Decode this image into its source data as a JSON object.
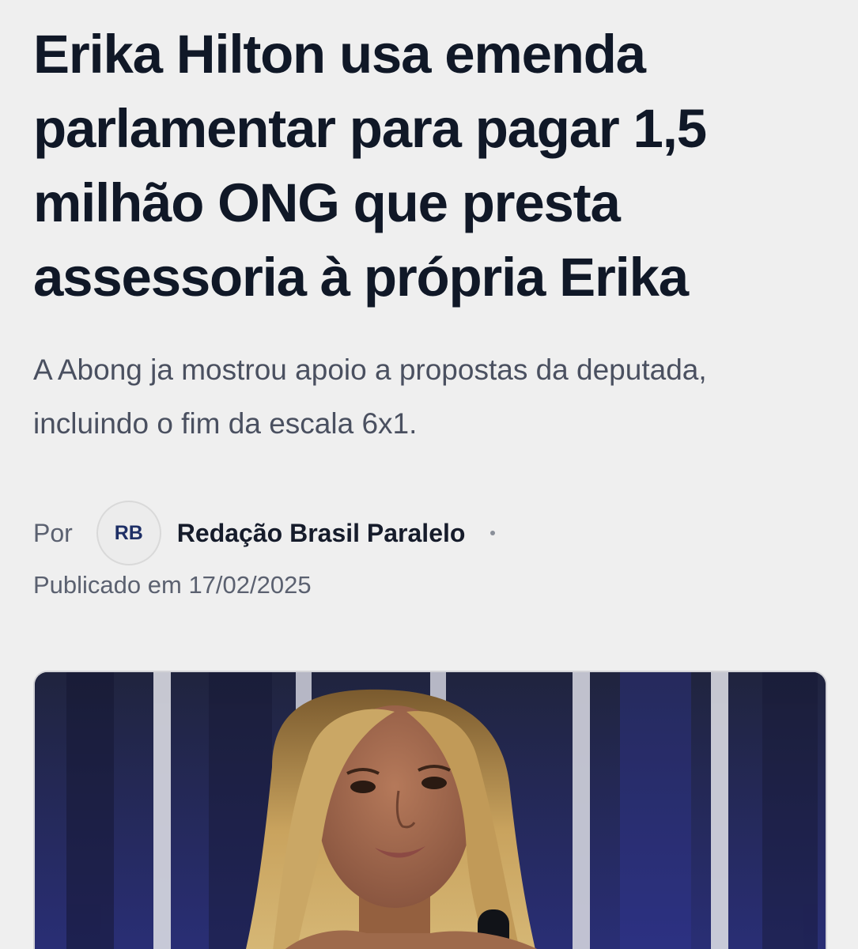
{
  "article": {
    "headline": "Erika Hilton usa emenda parlamentar para pagar 1,5 milhão ONG que presta assessoria à própria Erika",
    "subtitle": "A Abong ja mostrou apoio a propostas da deputada, incluindo o fim da escala 6x1.",
    "byline": {
      "prefix": "Por",
      "avatar_initials": "RB",
      "author": "Redação Brasil Paralelo"
    },
    "published": "Publicado em 17/02/2025"
  },
  "colors": {
    "background": "#efefef",
    "headline": "#101827",
    "avatar_text": "#1e2f66",
    "muted_text": "#5b6170"
  },
  "hero_image": {
    "icon": "photo"
  }
}
